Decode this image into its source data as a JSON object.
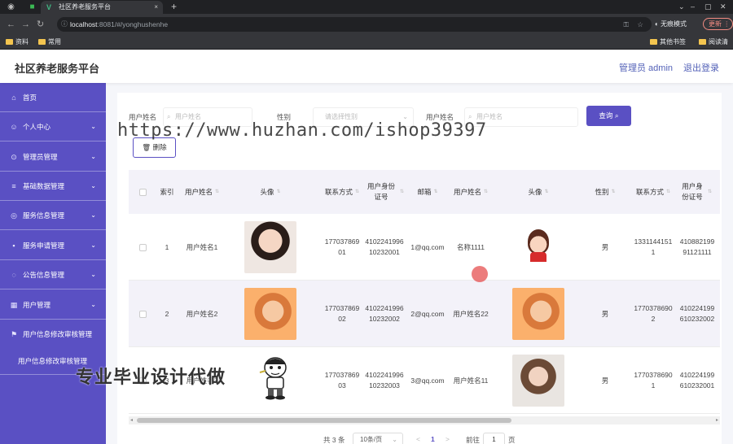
{
  "browser": {
    "tab_title": "社区养老服务平台",
    "tab_close": "×",
    "new_tab": "+",
    "url_host": "localhost",
    "url_path": ":8081/#/yonghushenhe",
    "incognito_label": "无痕模式",
    "update_label": "更新",
    "bookmarks": [
      "资料",
      "常用",
      "其他书签",
      "阅读清单"
    ]
  },
  "header": {
    "app_title": "社区养老服务平台",
    "admin_label": "管理员 admin",
    "logout_label": "退出登录"
  },
  "sidebar": {
    "items": [
      {
        "label": "首页",
        "icon": "home-icon",
        "has_children": false
      },
      {
        "label": "个人中心",
        "icon": "user-icon",
        "has_children": true
      },
      {
        "label": "管理员管理",
        "icon": "settings-icon",
        "has_children": true
      },
      {
        "label": "基础数据管理",
        "icon": "menu-icon",
        "has_children": true
      },
      {
        "label": "服务信息管理",
        "icon": "service-icon",
        "has_children": true
      },
      {
        "label": "服务申请管理",
        "icon": "chat-icon",
        "has_children": true
      },
      {
        "label": "公告信息管理",
        "icon": "notice-icon",
        "has_children": true
      },
      {
        "label": "用户管理",
        "icon": "users-icon",
        "has_children": true
      },
      {
        "label": "用户信息修改审核管理",
        "icon": "flag-icon",
        "has_children": false
      }
    ],
    "active_submenu": "用户信息修改审核管理"
  },
  "search": {
    "label1": "用户姓名",
    "placeholder1": "用户姓名",
    "label2": "性别",
    "placeholder2": "请选择性别",
    "label3": "用户姓名",
    "placeholder3": "用户姓名",
    "query_button": "查询"
  },
  "actions": {
    "delete_button": "删除"
  },
  "watermark_text": "https://www.huzhan.com/ishop39397",
  "table": {
    "columns": [
      "索引",
      "用户姓名",
      "头像",
      "联系方式",
      "用户身份证号",
      "邮箱",
      "用户姓名",
      "头像",
      "性别",
      "联系方式",
      "用户身份证号"
    ],
    "rows": [
      {
        "index": "1",
        "name": "用户姓名1",
        "phone": "17703786901",
        "id_card": "410224199610232001",
        "email": "1@qq.com",
        "name2": "名称1111",
        "gender": "男",
        "phone2": "13311441511",
        "id_card2": "41088219991121111"
      },
      {
        "index": "2",
        "name": "用户姓名2",
        "phone": "17703786902",
        "id_card": "410224199610232002",
        "email": "2@qq.com",
        "name2": "用户姓名22",
        "gender": "男",
        "phone2": "17703786902",
        "id_card2": "410224199610232002"
      },
      {
        "index": "3",
        "name": "用户姓名3",
        "phone": "17703786903",
        "id_card": "410224199610232003",
        "email": "3@qq.com",
        "name2": "用户姓名11",
        "gender": "男",
        "phone2": "17703786901",
        "id_card2": "410224199610232001"
      }
    ]
  },
  "pagination": {
    "total": "共 3 条",
    "page_size": "10条/页",
    "prev": "<",
    "current_page": "1",
    "next": ">",
    "goto_label": "前往",
    "goto_value": "1",
    "page_suffix": "页"
  },
  "promo_text": "专业毕业设计代做"
}
